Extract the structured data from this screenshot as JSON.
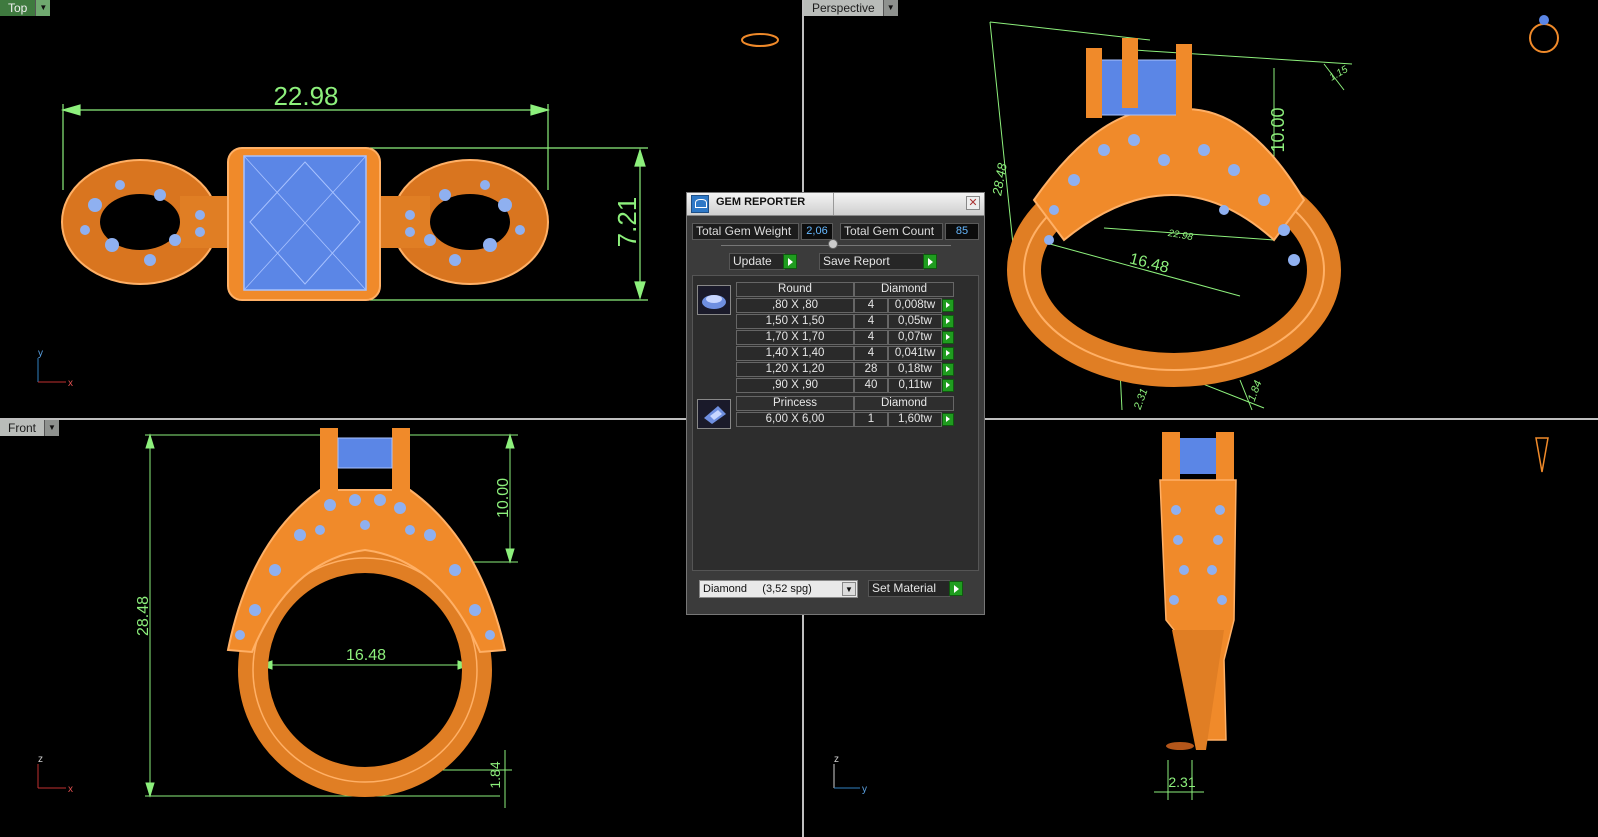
{
  "viewports": {
    "top": {
      "label": "Top",
      "dims": {
        "width": "22.98",
        "height": "7.21"
      },
      "axis": {
        "a": "y",
        "b": "x"
      }
    },
    "perspective": {
      "label": "Perspective",
      "dims": {
        "height": "28.48",
        "gem": "10.00",
        "inner": "16.48",
        "small_a": "2.31",
        "small_b": "1.84",
        "small_c": "1.15",
        "mid": "22.98"
      }
    },
    "front": {
      "label": "Front",
      "dims": {
        "height": "28.48",
        "gem": "10.00",
        "inner": "16.48",
        "base": "1.84"
      },
      "axis": {
        "a": "z",
        "b": "x"
      }
    },
    "right": {
      "dims": {
        "shank": "2.31"
      },
      "axis": {
        "a": "z",
        "b": "y"
      }
    }
  },
  "gem_reporter": {
    "title": "GEM REPORTER",
    "total_weight_label": "Total Gem Weight",
    "total_weight": "2,06",
    "total_count_label": "Total Gem Count",
    "total_count": "85",
    "update_label": "Update",
    "save_label": "Save Report",
    "groups": [
      {
        "shape": "Round",
        "material": "Diamond",
        "rows": [
          {
            "size": ",80 X ,80",
            "count": "4",
            "weight": "0,008tw"
          },
          {
            "size": "1,50 X 1,50",
            "count": "4",
            "weight": "0,05tw"
          },
          {
            "size": "1,70 X 1,70",
            "count": "4",
            "weight": "0,07tw"
          },
          {
            "size": "1,40 X 1,40",
            "count": "4",
            "weight": "0,041tw"
          },
          {
            "size": "1,20 X 1,20",
            "count": "28",
            "weight": "0,18tw"
          },
          {
            "size": ",90 X ,90",
            "count": "40",
            "weight": "0,11tw"
          }
        ]
      },
      {
        "shape": "Princess",
        "material": "Diamond",
        "rows": [
          {
            "size": "6,00 X 6,00",
            "count": "1",
            "weight": "1,60tw"
          }
        ]
      }
    ],
    "material_select": "Diamond     (3,52 spg)",
    "set_material_label": "Set Material"
  },
  "colors": {
    "metal": "#f08a2a",
    "metal_dark": "#b4561a",
    "gem": "#6f9cf0",
    "dimension": "#8df07c",
    "viewport_bg": "#000000"
  }
}
